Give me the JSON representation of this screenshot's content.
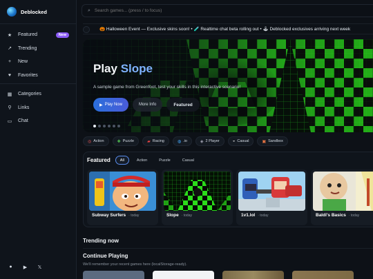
{
  "brand": {
    "name": "Deblocked"
  },
  "sidebar": {
    "items": [
      {
        "icon": "star-icon",
        "glyph": "★",
        "label": "Featured",
        "badge": "New"
      },
      {
        "icon": "trending-icon",
        "glyph": "↗",
        "label": "Trending"
      },
      {
        "icon": "plus-icon",
        "glyph": "+",
        "label": "New"
      },
      {
        "icon": "heart-icon",
        "glyph": "♥",
        "label": "Favorites"
      }
    ],
    "items2": [
      {
        "icon": "categories-icon",
        "glyph": "▦",
        "label": "Categories"
      },
      {
        "icon": "link-icon",
        "glyph": "⚲",
        "label": "Links"
      },
      {
        "icon": "chat-icon",
        "glyph": "▭",
        "label": "Chat"
      }
    ],
    "social": [
      {
        "icon": "discord-icon",
        "glyph": "●"
      },
      {
        "icon": "youtube-icon",
        "glyph": "▶"
      },
      {
        "icon": "x-icon",
        "glyph": "𝕏"
      }
    ]
  },
  "search": {
    "placeholder": "Search games... (press / to focus)"
  },
  "ticker": {
    "text": "🎃 Halloween Event — Exclusive skins soon! • 🧪 Realtime chat beta rolling out • 🕹 Deblocked exclusives arriving next week"
  },
  "hero": {
    "title_a": "Play",
    "title_b": "Slope",
    "description": "A sample game from Greenfoot, test your skills in this interactive scenario!",
    "play_label": "Play Now",
    "info_label": "More Info",
    "featured_label": "Featured"
  },
  "categories": [
    {
      "icon": "action-icon",
      "glyph": "◎",
      "label": "Action"
    },
    {
      "icon": "puzzle-icon",
      "glyph": "✚",
      "label": "Puzzle"
    },
    {
      "icon": "car-icon",
      "glyph": "▰",
      "label": "Racing"
    },
    {
      "icon": "globe-icon",
      "glyph": "◍",
      "label": ".io"
    },
    {
      "icon": "gamepad-icon",
      "glyph": "◈",
      "label": "2 Player"
    },
    {
      "icon": "casual-icon",
      "glyph": "◒",
      "label": "Casual"
    },
    {
      "icon": "sandbox-icon",
      "glyph": "▣",
      "label": "Sandbox"
    }
  ],
  "featured": {
    "title": "Featured",
    "tabs": [
      "All",
      "Action",
      "Puzzle",
      "Casual"
    ],
    "active_tab": "All",
    "cards": [
      {
        "name": "Subway Surfers",
        "meta": "· today"
      },
      {
        "name": "Slope",
        "meta": "· today"
      },
      {
        "name": "1v1.lol",
        "meta": "· today"
      },
      {
        "name": "Baldi's Basics",
        "meta": "· today"
      }
    ]
  },
  "trending": {
    "title": "Trending now"
  },
  "continue": {
    "title": "Continue Playing",
    "subtitle": "We'll remember your recent games here (localStorage-ready)."
  },
  "colors": {
    "accent": "#5a8dee",
    "badge": "#8b5cf6",
    "bg": "#0d1117",
    "neon": "#39ff14"
  }
}
